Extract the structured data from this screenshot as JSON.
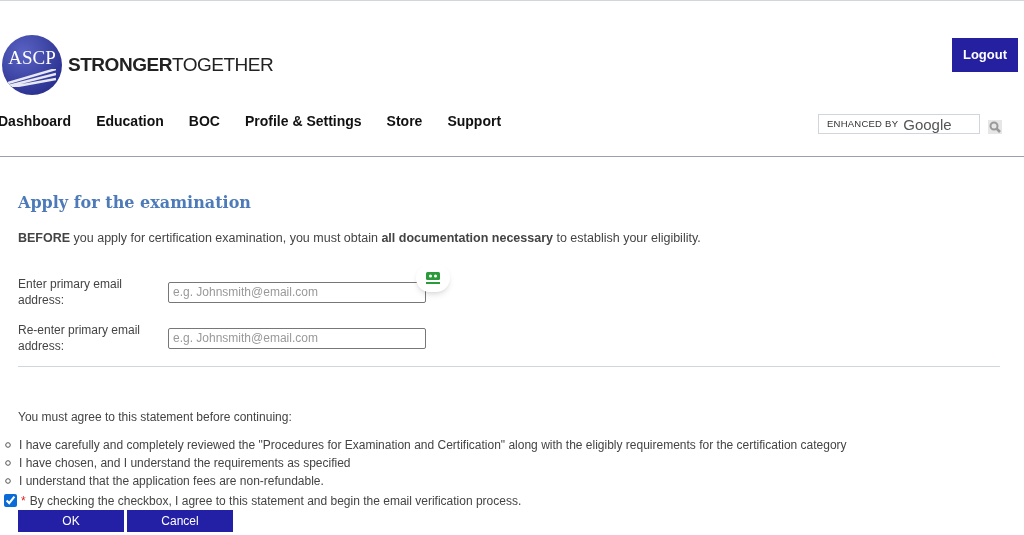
{
  "header": {
    "logo_badge": "ASCP",
    "logo_text_bold": "STRONGER",
    "logo_text_light": "TOGETHER",
    "logout": "Logout"
  },
  "nav": [
    {
      "label": "Dashboard"
    },
    {
      "label": "Education"
    },
    {
      "label": "BOC"
    },
    {
      "label": "Profile & Settings"
    },
    {
      "label": "Store"
    },
    {
      "label": "Support"
    }
  ],
  "search": {
    "placeholder_prefix": "ENHANCED BY",
    "placeholder_brand": "Google"
  },
  "form": {
    "title": "Apply for the examination",
    "intro": "**BEFORE** you apply for certification examination, you must obtain **all documentation necessary** to establish your eligibility.",
    "fields": [
      {
        "label": "Enter primary email address:",
        "placeholder": "e.g. Johnsmith@email.com"
      },
      {
        "label": "Re-enter primary email address:",
        "placeholder": "e.g. Johnsmith@email.com"
      }
    ],
    "statement": "You must agree to this statement before continuing:",
    "items": [
      "I have carefully and completely reviewed the \"Procedures for Examination and Certification\" along with the eligibly requirements for the certification category",
      "I have chosen, and I understand the requirements as specified",
      "I understand that the application fees are non-refundable."
    ],
    "agree": {
      "checked": true,
      "required_mark": "*",
      "label": "By checking the checkbox, I agree to this statement and begin the email verification process."
    },
    "buttons": [
      "OK",
      "Cancel"
    ]
  }
}
